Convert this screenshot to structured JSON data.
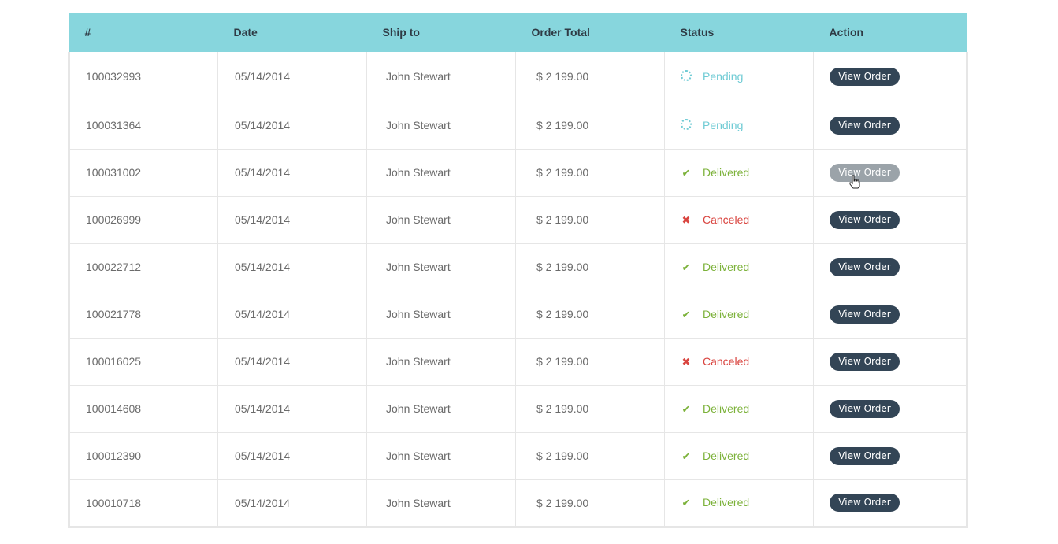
{
  "table": {
    "headers": [
      "#",
      "Date",
      "Ship to",
      "Order Total",
      "Status",
      "Action"
    ],
    "rows": [
      {
        "id": "100032993",
        "date": "05/14/2014",
        "ship_to": "John Stewart",
        "total": "$ 2 199.00",
        "status": "Pending",
        "action": "View Order"
      },
      {
        "id": "100031364",
        "date": "05/14/2014",
        "ship_to": "John Stewart",
        "total": "$ 2 199.00",
        "status": "Pending",
        "action": "View Order"
      },
      {
        "id": "100031002",
        "date": "05/14/2014",
        "ship_to": "John Stewart",
        "total": "$ 2 199.00",
        "status": "Delivered",
        "action": "View Order"
      },
      {
        "id": "100026999",
        "date": "05/14/2014",
        "ship_to": "John Stewart",
        "total": "$ 2 199.00",
        "status": "Canceled",
        "action": "View Order"
      },
      {
        "id": "100022712",
        "date": "05/14/2014",
        "ship_to": "John Stewart",
        "total": "$ 2 199.00",
        "status": "Delivered",
        "action": "View Order"
      },
      {
        "id": "100021778",
        "date": "05/14/2014",
        "ship_to": "John Stewart",
        "total": "$ 2 199.00",
        "status": "Delivered",
        "action": "View Order"
      },
      {
        "id": "100016025",
        "date": "05/14/2014",
        "ship_to": "John Stewart",
        "total": "$ 2 199.00",
        "status": "Canceled",
        "action": "View Order"
      },
      {
        "id": "100014608",
        "date": "05/14/2014",
        "ship_to": "John Stewart",
        "total": "$ 2 199.00",
        "status": "Delivered",
        "action": "View Order"
      },
      {
        "id": "100012390",
        "date": "05/14/2014",
        "ship_to": "John Stewart",
        "total": "$ 2 199.00",
        "status": "Delivered",
        "action": "View Order"
      },
      {
        "id": "100010718",
        "date": "05/14/2014",
        "ship_to": "John Stewart",
        "total": "$ 2 199.00",
        "status": "Delivered",
        "action": "View Order"
      }
    ]
  },
  "status_styles": {
    "Pending": {
      "icon": "spinner-icon",
      "color": "#6fcbd4"
    },
    "Delivered": {
      "icon": "check-icon",
      "color": "#7cb23a"
    },
    "Canceled": {
      "icon": "cross-icon",
      "color": "#d9443f"
    }
  },
  "colors": {
    "header_bg": "#87d6dd",
    "button_bg": "#334556",
    "button_hover_bg": "#9ba3a9"
  }
}
